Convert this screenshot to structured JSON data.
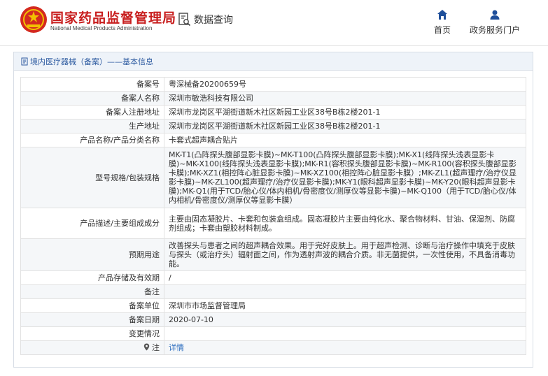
{
  "header": {
    "site_title": "国家药品监督管理局",
    "site_subtitle": "National Medical Products Administration",
    "query_label": "数据查询",
    "nav": [
      {
        "label": "首页",
        "icon": "home-icon"
      },
      {
        "label": "政务服务门户",
        "icon": "user-icon"
      }
    ]
  },
  "panel": {
    "title": "境内医疗器械（备案）——基本信息"
  },
  "rows": [
    {
      "label": "备案号",
      "value": "粤深械备20200659号"
    },
    {
      "label": "备案人名称",
      "value": "深圳市敏浩科技有限公司"
    },
    {
      "label": "备案人注册地址",
      "value": "深圳市龙岗区平湖街道新木社区新园工业区38号B栋2楼201-1"
    },
    {
      "label": "生产地址",
      "value": "深圳市龙岗区平湖街道新木社区新园工业区38号B栋2楼201-1"
    },
    {
      "label": "产品名称/产品分类名称",
      "value": "卡套式超声耦合贴片"
    },
    {
      "label": "型号规格/包装规格",
      "value": "MK-T1(凸阵探头腹部显影卡膜)~MK-T100(凸阵探头腹部显影卡膜);MK-X1(线阵探头浅表显影卡膜)~MK-X100(线阵探头浅表显影卡膜);MK-R1(容积探头腹部显影卡膜)~MK-R100(容积探头腹部显影卡膜);MK-XZ1(相控阵心脏显影卡膜)~MK-XZ100(相控阵心脏显影卡膜）;MK-ZL1(超声理疗/治疗仪显影卡膜)~MK-ZL100(超声理疗/治疗仪显影卡膜);MK-Y1(眼科超声显影卡膜)~MK-Y20(眼科超声显影卡膜);MK-Q1(用于TCD/胎心仪/体内相机/骨密度仪/测厚仪等显影卡膜)~MK-Q100（用于TCD/胎心仪/体内相机/骨密度仪/测厚仪等显影卡膜）"
    },
    {
      "label": "产品描述/主要组成成分",
      "value": "主要由固态凝胶片、卡套和包装盒组成。固态凝胶片主要由纯化水、聚合物材料、甘油、保湿剂、防腐剂组成；卡套由塑胶材料制成。"
    },
    {
      "label": "预期用途",
      "value": "改善探头与患者之间的超声耦合效果。用于完好皮肤上。用于超声检测、诊断与治疗操作中填充于皮肤与探头（或治疗头）辐射面之间，作为透射声波的耦合介质。非无菌提供，一次性使用，不具备消毒功能。"
    },
    {
      "label": "产品存储及有效期",
      "value": "/"
    },
    {
      "label": "备注",
      "value": ""
    },
    {
      "label": "备案单位",
      "value": "深圳市市场监督管理局"
    },
    {
      "label": "备案日期",
      "value": "2020-07-10"
    },
    {
      "label": "变更情况",
      "value": ""
    },
    {
      "label": "注",
      "value": "详情"
    }
  ]
}
